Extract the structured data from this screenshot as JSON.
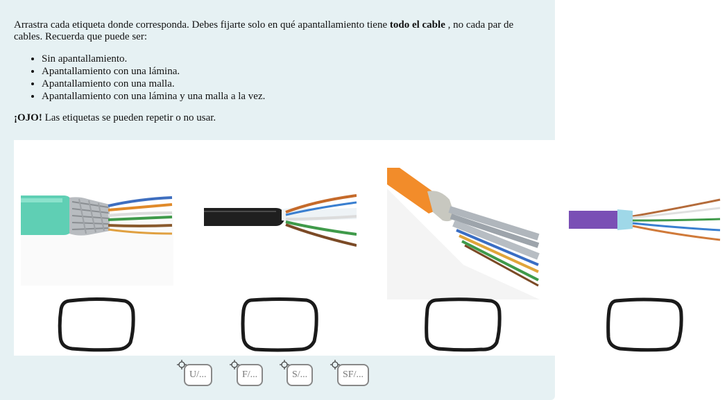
{
  "instructions": {
    "intro_start": "Arrastra cada etiqueta donde corresponda. Debes fijarte solo en qué apantallamiento tiene ",
    "intro_bold": "todo el cable",
    "intro_end": " , no cada par de cables. Recuerda que puede ser:",
    "options": [
      "Sin apantallamiento.",
      "Apantallamiento con una lámina.",
      "Apantallamiento con una malla.",
      "Apantallamiento con una lámina y una malla a la vez."
    ],
    "note_bold": "¡OJO!",
    "note_text": " Las etiquetas se pueden repetir o no usar."
  },
  "labels": [
    "U/...",
    "F/...",
    "S/...",
    "SF/..."
  ],
  "colors": {
    "panel_bg": "#e6f1f3",
    "dropzone_stroke": "#1a1a1a",
    "label_border": "#888888",
    "label_text": "#777777"
  },
  "icons": [
    "move-handle-icon",
    "cable-image"
  ]
}
